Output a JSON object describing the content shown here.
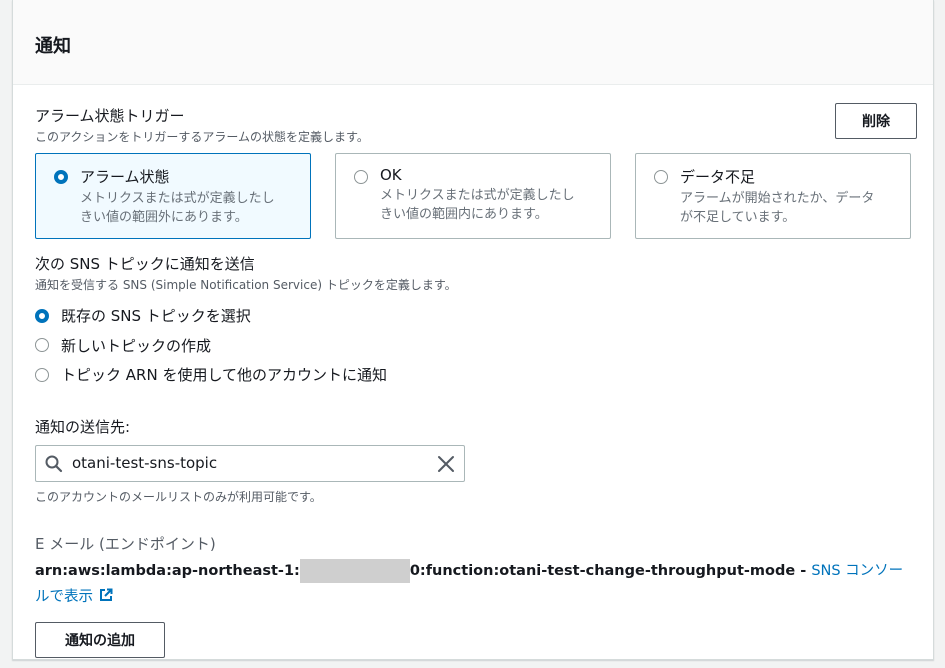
{
  "panel": {
    "title": "通知"
  },
  "trigger": {
    "label": "アラーム状態トリガー",
    "description": "このアクションをトリガーするアラームの状態を定義します。",
    "delete_label": "削除",
    "options": [
      {
        "label": "アラーム状態",
        "desc1": "メトリクスまたは式が定義したし",
        "desc2": "きい値の範囲外にあります。",
        "selected": true
      },
      {
        "label": "OK",
        "desc1": "メトリクスまたは式が定義したし",
        "desc2": "きい値の範囲内にあります。",
        "selected": false
      },
      {
        "label": "データ不足",
        "desc1": "アラームが開始されたか、データ",
        "desc2": "が不足しています。",
        "selected": false
      }
    ]
  },
  "sns": {
    "label": "次の SNS トピックに通知を送信",
    "description": "通知を受信する SNS (Simple Notification Service) トピックを定義します。",
    "options": [
      {
        "label": "既存の SNS トピックを選択",
        "selected": true
      },
      {
        "label": "新しいトピックの作成",
        "selected": false
      },
      {
        "label": "トピック ARN を使用して他のアカウントに通知",
        "selected": false
      }
    ]
  },
  "destination": {
    "label": "通知の送信先:",
    "value": "otani-test-sns-topic",
    "constraint": "このアカウントのメールリストのみが利用可能です。"
  },
  "endpoint": {
    "label": "E メール (エンドポイント)",
    "arn_prefix": "arn:aws:lambda:ap-northeast-1:",
    "arn_suffix": "0:function:otani-test-change-throughput-mode - ",
    "console_link": "SNS コンソールで表示"
  },
  "add_notification_label": "通知の追加",
  "colors": {
    "accent": "#0073bb",
    "border": "#aab7b8",
    "text": "#16191f",
    "muted": "#545b64"
  },
  "icons": {
    "search": "search-icon",
    "clear": "close-icon",
    "external": "external-link-icon"
  }
}
